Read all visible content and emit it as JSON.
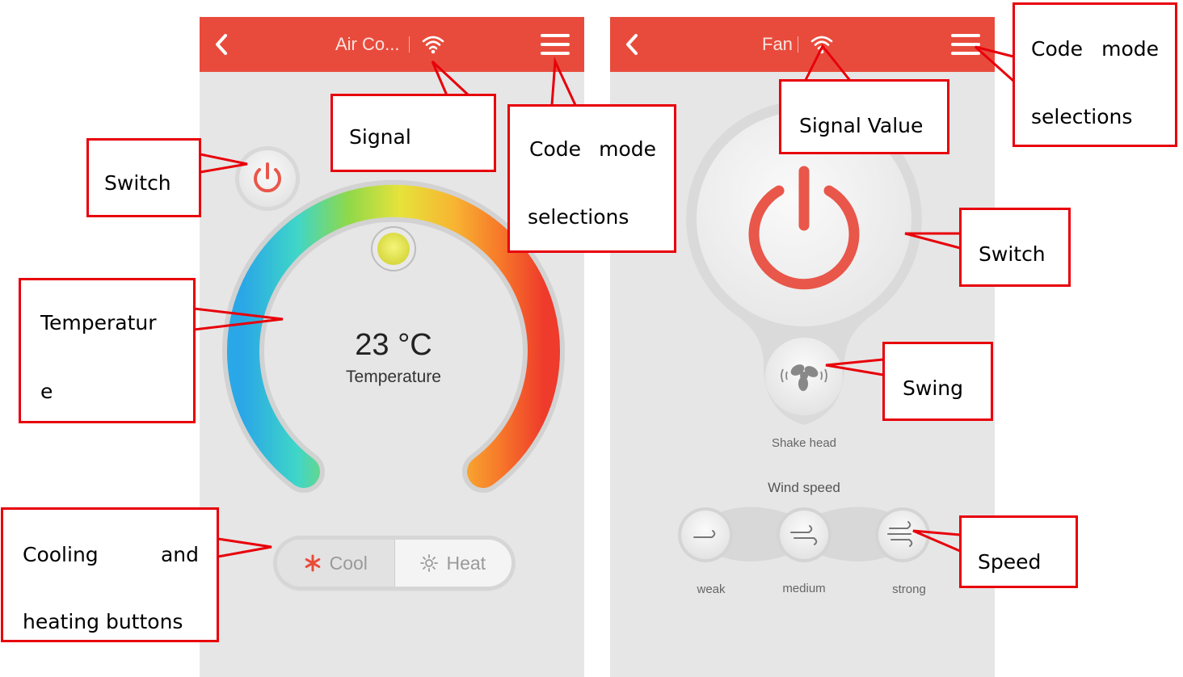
{
  "screen_ac": {
    "title": "Air Co...",
    "temperature": "23 °C",
    "temperature_label": "Temperature",
    "cool_label": "Cool",
    "heat_label": "Heat"
  },
  "screen_fan": {
    "title": "Fan",
    "shake_head": "Shake head",
    "wind_speed": "Wind speed",
    "weak": "weak",
    "medium": "medium",
    "strong": "strong"
  },
  "annotations": {
    "switch_left": "Switch",
    "signal_left": "Signal",
    "code_mode_left_1": "Code",
    "code_mode_left_2": "mode",
    "code_mode_left_3": "selections",
    "temperature_1": "Temperatur",
    "temperature_2": "e",
    "cooling_1": "Cooling",
    "cooling_2": "and",
    "cooling_3": "heating buttons",
    "signal_value": "Signal Value",
    "code_mode_right_1": "Code",
    "code_mode_right_2": "mode",
    "code_mode_right_3": "selections",
    "switch_right": "Switch",
    "swing": "Swing",
    "speed": "Speed"
  },
  "colors": {
    "topbar": "#e84b3c",
    "power": "#e8574a",
    "callout_border": "#e8000a",
    "phone_bg": "#e6e6e6"
  },
  "icons": [
    "back-arrow-icon",
    "wifi-signal-icon",
    "menu-icon",
    "power-icon",
    "snowflake-icon",
    "sun-icon",
    "fan-swing-icon",
    "wind-weak-icon",
    "wind-medium-icon",
    "wind-strong-icon"
  ]
}
